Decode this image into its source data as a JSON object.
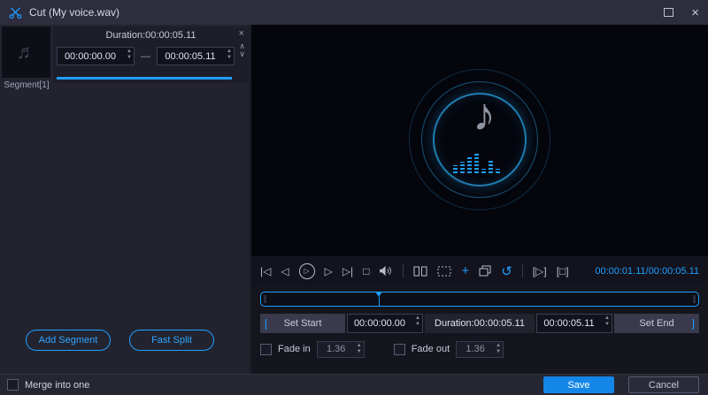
{
  "colors": {
    "accent": "#1e9fff",
    "save_button": "#1486e8"
  },
  "titlebar": {
    "title": "Cut (My voice.wav)"
  },
  "segment_panel": {
    "thumbnail_label": "Segment[1]",
    "duration_label": "Duration:00:00:05.11",
    "start": "00:00:00.00",
    "end": "00:00:05.11"
  },
  "left_buttons": {
    "add_segment": "Add Segment",
    "fast_split": "Fast Split"
  },
  "player": {
    "time_display": "00:00:01.11/00:00:05.11",
    "progress_percent": 27
  },
  "trim": {
    "bracket_left": "[",
    "set_start": "Set Start",
    "start": "00:00:00.00",
    "duration_label": "Duration:00:00:05.11",
    "end": "00:00:05.11",
    "set_end": "Set End",
    "bracket_right": "]"
  },
  "fade": {
    "fade_in_label": "Fade in",
    "fade_in_value": "1.36",
    "fade_in_checked": false,
    "fade_out_label": "Fade out",
    "fade_out_value": "1.36",
    "fade_out_checked": false
  },
  "footer": {
    "merge_label": "Merge into one",
    "merge_checked": false,
    "save": "Save",
    "cancel": "Cancel"
  },
  "icons": {
    "close": "×",
    "panel_close": "×",
    "move_up": "∧",
    "move_down": "∨",
    "spin_up": "▲",
    "spin_down": "▼",
    "thumb_note": "♬",
    "note": "♪",
    "dash": "—",
    "skip_start": "|◁",
    "step_back": "◁",
    "play": "▷",
    "step_forward": "▷",
    "skip_end": "▷|",
    "stop": "□",
    "add": "+",
    "undo": "↺",
    "play_selection": "[▷]",
    "selection": "[□]"
  }
}
